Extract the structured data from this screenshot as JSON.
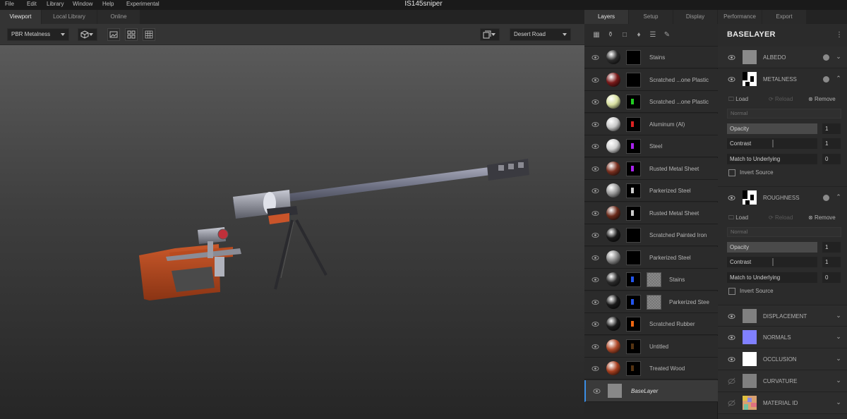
{
  "app": {
    "title": "IS145sniper"
  },
  "menu": [
    "File",
    "Edit",
    "Library",
    "Window",
    "Help",
    "Experimental"
  ],
  "left_tabs": [
    {
      "label": "Viewport",
      "active": true
    },
    {
      "label": "Local Library",
      "active": false
    },
    {
      "label": "Online",
      "active": false
    }
  ],
  "right_tabs": [
    {
      "label": "Layers",
      "active": true
    },
    {
      "label": "Setup",
      "active": false
    },
    {
      "label": "Display",
      "active": false
    },
    {
      "label": "Performance",
      "active": false
    },
    {
      "label": "Export",
      "active": false
    }
  ],
  "viewport_toolbar": {
    "render_mode": "PBR Metalness",
    "environment": "Desert Road"
  },
  "layers": [
    {
      "name": "Stains",
      "ball": "#2a2a2a",
      "mask_mark": "",
      "extra_mask": false
    },
    {
      "name": "Scratched ...one Plastic",
      "ball": "#7a1a1a",
      "mask_mark": "",
      "extra_mask": false
    },
    {
      "name": "Scratched ...one Plastic",
      "ball": "#d8e0a0",
      "mask_mark": "#22cc22",
      "extra_mask": false
    },
    {
      "name": "Aluminum (Al)",
      "ball": "#c8c8c8",
      "mask_mark": "#dd2222",
      "extra_mask": false
    },
    {
      "name": "Steel",
      "ball": "#d0d0d0",
      "mask_mark": "#aa22ee",
      "extra_mask": false
    },
    {
      "name": "Rusted Metal Sheet",
      "ball": "#7a3020",
      "mask_mark": "#aa22ee",
      "extra_mask": false
    },
    {
      "name": "Parkerized Steel",
      "ball": "#9a9a9a",
      "mask_mark": "#cccccc",
      "extra_mask": false
    },
    {
      "name": "Rusted Metal Sheet",
      "ball": "#6a2a1a",
      "mask_mark": "#cccccc",
      "extra_mask": false
    },
    {
      "name": "Scratched Painted Iron",
      "ball": "#1a1a1a",
      "mask_mark": "",
      "extra_mask": false
    },
    {
      "name": "Parkerized Steel",
      "ball": "#8a8a8a",
      "mask_mark": "",
      "extra_mask": false
    },
    {
      "name": "Stains",
      "ball": "#2a2a2a",
      "mask_mark": "#2255ee",
      "extra_mask": true
    },
    {
      "name": "Parkerized Stee",
      "ball": "#1a1a1a",
      "mask_mark": "#2255ee",
      "extra_mask": true
    },
    {
      "name": "Scratched Rubber",
      "ball": "#1c1c1c",
      "mask_mark": "#ee6611",
      "extra_mask": false
    },
    {
      "name": "Untitled",
      "ball": "#b04a2a",
      "mask_mark": "#553311",
      "extra_mask": false
    },
    {
      "name": "Treated Wood",
      "ball": "#a84020",
      "mask_mark": "#553311",
      "extra_mask": false
    },
    {
      "name": "BaseLayer",
      "ball": "#888888",
      "mask_mark": "",
      "extra_mask": false,
      "selected": true
    }
  ],
  "properties": {
    "title": "BASELAYER",
    "channels": [
      {
        "name": "ALBEDO",
        "thumb": "#8a8a8a"
      },
      {
        "name": "METALNESS",
        "thumb": "pattern",
        "expanded": true
      },
      {
        "name": "ROUGHNESS",
        "thumb": "pattern",
        "expanded": true
      },
      {
        "name": "DISPLACEMENT",
        "thumb": "#808080"
      },
      {
        "name": "NORMALS",
        "thumb": "#8080ff"
      },
      {
        "name": "OCCLUSION",
        "thumb": "#ffffff"
      },
      {
        "name": "CURVATURE",
        "thumb": "#808080"
      },
      {
        "name": "MATERIAL ID",
        "thumb": "multicolor"
      }
    ],
    "load_label": "Load",
    "reload_label": "Reload",
    "remove_label": "Remove",
    "blend_mode": "Normal",
    "opacity_label": "Opacity",
    "opacity_value": "1",
    "contrast_label": "Contrast",
    "contrast_value": "1",
    "match_label": "Match to Underlying",
    "match_value": "0",
    "invert_label": "Invert Source"
  }
}
